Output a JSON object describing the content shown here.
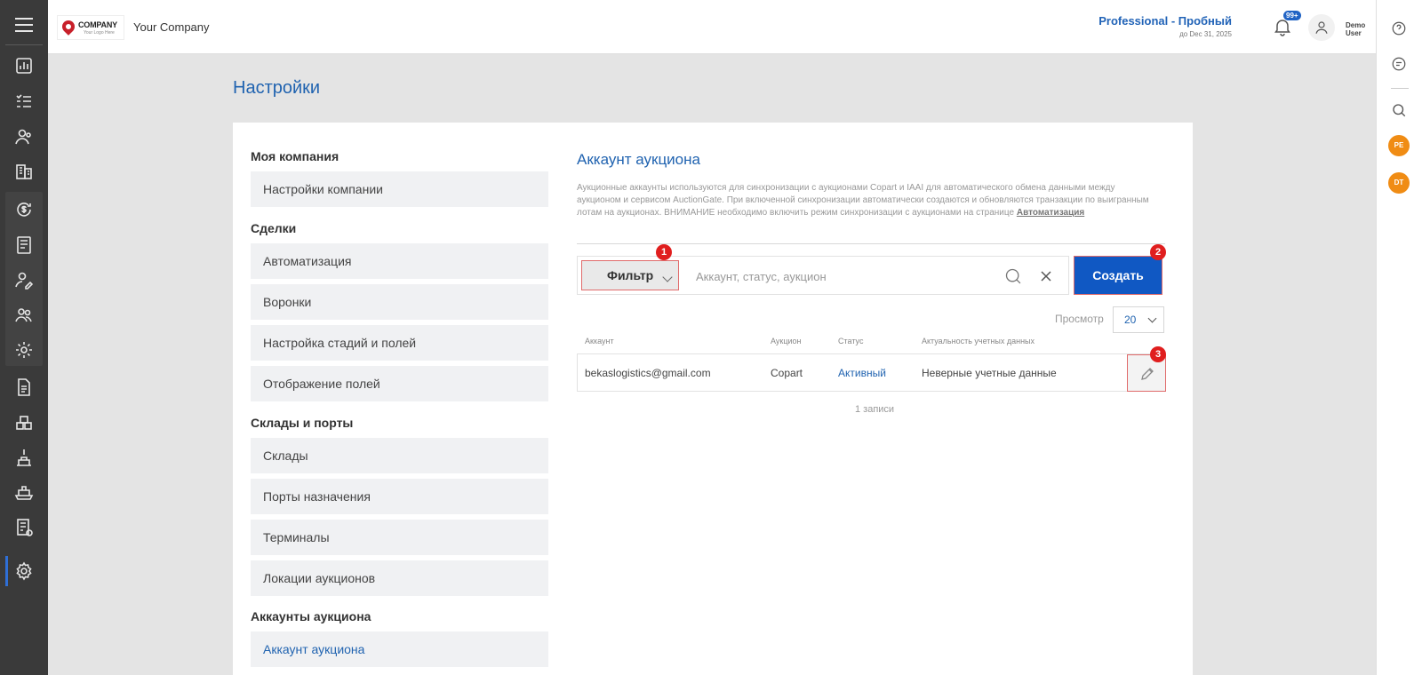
{
  "header": {
    "logo_text": "COMPANY",
    "logo_sub": "Your Logo Here",
    "company_name": "Your Company",
    "plan": "Professional - Пробный",
    "plan_until": "до Dec 31, 2025",
    "notifications_badge": "99+",
    "user_name_line1": "Demo",
    "user_name_line2": "User"
  },
  "left_nav": {
    "icons": [
      "menu-icon",
      "dashboard-icon",
      "checklist-icon",
      "contacts-icon",
      "buildings-icon",
      "dollar-refresh-icon",
      "document-icon",
      "user-edit-icon",
      "users-icon",
      "settings-cog-icon",
      "file-icon",
      "warehouse-icon",
      "crane-icon",
      "ship-icon",
      "calculator-doc-icon",
      "gear-icon"
    ],
    "active": "gear-icon"
  },
  "right_rail": {
    "icons": [
      "help-icon",
      "chat-icon",
      "search-icon"
    ],
    "avatars": [
      "PE",
      "DT"
    ]
  },
  "page": {
    "title": "Настройки"
  },
  "settings_menu": {
    "sections": [
      {
        "heading": "Моя компания",
        "items": [
          "Настройки компании"
        ]
      },
      {
        "heading": "Сделки",
        "items": [
          "Автоматизация",
          "Воронки",
          "Настройка стадий и полей",
          "Отображение полей"
        ]
      },
      {
        "heading": "Склады и порты",
        "items": [
          "Склады",
          "Порты назначения",
          "Терминалы",
          "Локации аукционов"
        ]
      },
      {
        "heading": "Аккаунты аукциона",
        "items": [
          "Аккаунт аукциона"
        ]
      }
    ],
    "active_item": "Аккаунт аукциона"
  },
  "main": {
    "title": "Аккаунт аукциона",
    "description": "Аукционные аккаунты используются для синхронизации с аукционами Copart и IAAI для автоматического обмена данными между аукционом и сервисом AuctionGate. При включенной синхронизации автоматически создаются и обновляются транзакции по выигранным лотам на аукционах. ВНИМАНИЕ необходимо включить режим синхронизации с аукционами на странице",
    "description_link": "Автоматизация",
    "filter_label": "Фильтр",
    "search_placeholder": "Аккаунт, статус, аукцион",
    "create_label": "Создать",
    "view_label": "Просмотр",
    "view_value": "20",
    "columns": [
      "Аккаунт",
      "Аукцион",
      "Статус",
      "Актуальность учетных данных"
    ],
    "rows": [
      {
        "account": "bekaslogistics@gmail.com",
        "auction": "Copart",
        "status": "Активный",
        "credentials": "Неверные учетные данные"
      }
    ],
    "records_text": "1 записи",
    "markers": [
      "1",
      "2",
      "3"
    ]
  },
  "colors": {
    "accent": "#2063b0",
    "primary_button": "#1058c3",
    "marker": "#e01e1e",
    "avatar": "#f08c14",
    "sidebar": "#3a3a3a"
  }
}
